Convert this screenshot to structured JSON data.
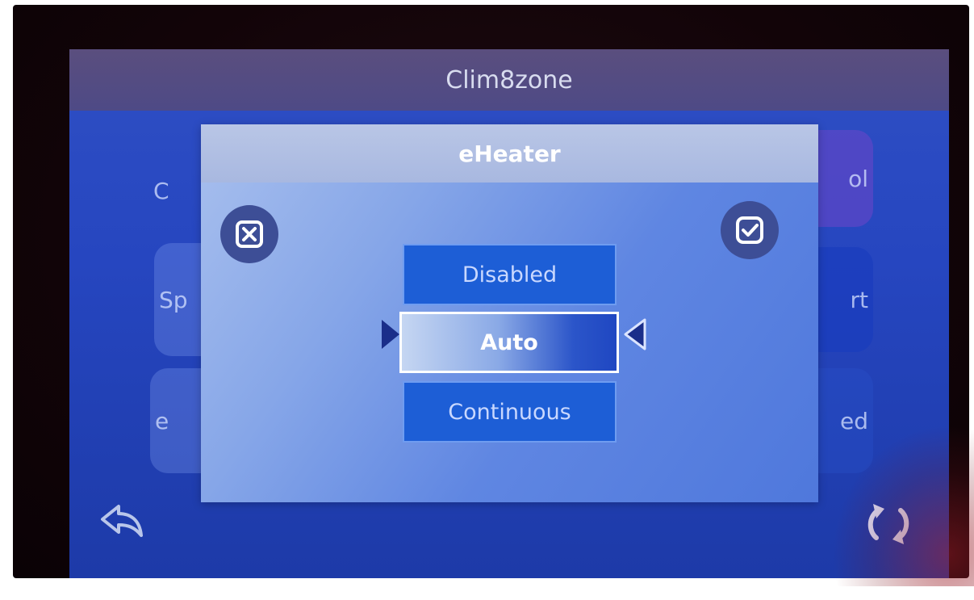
{
  "app": {
    "title": "Clim8zone"
  },
  "background_tiles": {
    "left": [
      "C",
      "Sp",
      "e"
    ],
    "right": [
      "ol",
      "rt",
      "ed"
    ]
  },
  "dialog": {
    "title": "eHeater",
    "cancel_icon": "close-box-icon",
    "confirm_icon": "checkbox-checked-icon",
    "options": [
      "Disabled",
      "Auto",
      "Continuous"
    ],
    "selected": "Auto"
  },
  "nav": {
    "back_icon": "back-arrow-icon",
    "refresh_icon": "refresh-icon"
  },
  "colors": {
    "screen_bg": "#2646c0",
    "title_bar": "#4e4a86",
    "dialog_bg": "#86a6e8",
    "option_bg": "#1d5ed6",
    "button_bg": "#3d4e96"
  }
}
